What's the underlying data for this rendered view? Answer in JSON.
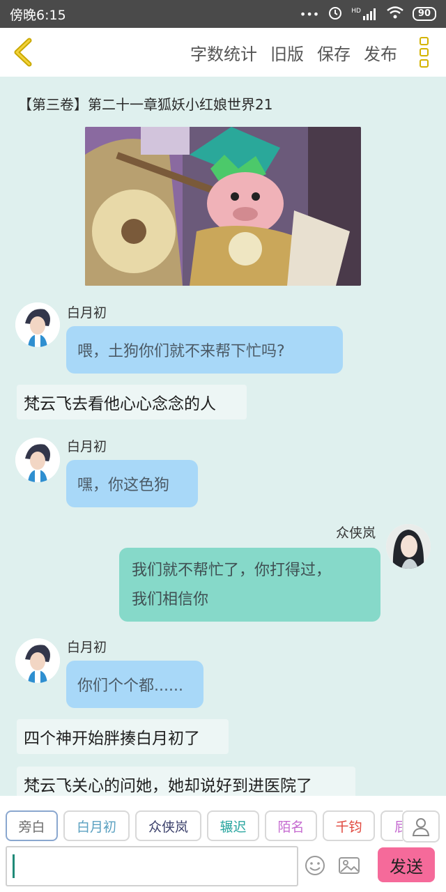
{
  "status_bar": {
    "time": "傍晚6:15",
    "signal_label": "HD",
    "battery": "90"
  },
  "toolbar": {
    "actions": [
      "字数统计",
      "旧版",
      "保存",
      "发布"
    ]
  },
  "chapter": {
    "title": "【第三卷】第二十一章狐妖小红娘世界21"
  },
  "messages": {
    "m1": {
      "name": "白月初",
      "text": "喂，土狗你们就不来帮下忙吗?"
    },
    "n1": "梵云飞去看他心心念念的人",
    "m2": {
      "name": "白月初",
      "text": "嘿，你这色狗"
    },
    "m3": {
      "name": "众侠岚",
      "line1": "我们就不帮忙了，你打得过，",
      "line2": "我们相信你"
    },
    "m4": {
      "name": "白月初",
      "text": "你们个个都......"
    },
    "n2": "四个神开始胖揍白月初了",
    "n3": "梵云飞关心的问她，她却说好到进医院了"
  },
  "characters": [
    "旁白",
    "白月初",
    "众侠岚",
    "辗迟",
    "陌名",
    "千钧",
    "屁"
  ],
  "character_colors": [
    "#6a6a6a",
    "#5aa0c0",
    "#3a3f6a",
    "#2aa6a0",
    "#c56ad0",
    "#e0463c",
    "#c56ad0"
  ],
  "send_label": "发送",
  "colors": {
    "accent": "#f56a9a",
    "left_bubble": "#a8d8f8",
    "right_bubble": "#86d9c9"
  }
}
